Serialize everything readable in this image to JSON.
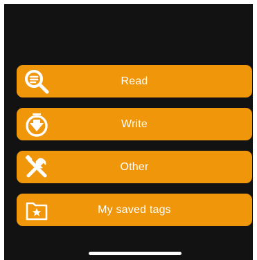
{
  "menu": {
    "read": {
      "label": "Read",
      "icon": "search-icon"
    },
    "write": {
      "label": "Write",
      "icon": "download-circle-icon"
    },
    "other": {
      "label": "Other",
      "icon": "tools-icon"
    },
    "saved": {
      "label": "My saved tags",
      "icon": "star-folder-icon"
    }
  },
  "colors": {
    "background": "#121212",
    "button": "#f0960a",
    "text": "#ffffff"
  }
}
